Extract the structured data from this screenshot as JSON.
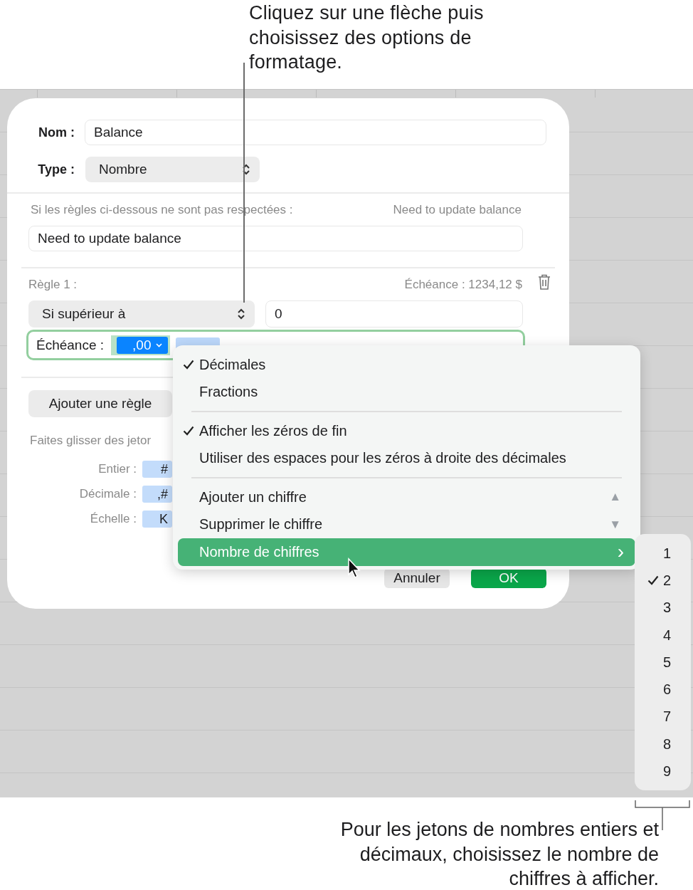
{
  "top_callout": "Cliquez sur une flèche puis choisissez des options de formatage.",
  "dialog": {
    "name_label": "Nom :",
    "name_value": "Balance",
    "type_label": "Type :",
    "type_value": "Nombre",
    "fallback_label": "Si les règles ci-dessous ne sont pas respectées :",
    "fallback_preview": "Need to update balance",
    "fallback_value": "Need to update balance",
    "rule_label": "Règle 1 :",
    "rule_preview": "Échéance : 1234,12 $",
    "condition": "Si supérieur à",
    "condition_value": "0",
    "format_label": "Échéance :",
    "format_token": {
      "text": ",00",
      "selected": true
    },
    "add_rule": "Ajouter une règle",
    "drag_hint": "Faites glisser des jetor",
    "tokens": [
      {
        "label": "Entier :",
        "token": "#"
      },
      {
        "label": "Décimale :",
        "token": ",#"
      },
      {
        "label": "Échelle :",
        "token": "K"
      }
    ],
    "cancel": "Annuler",
    "ok": "OK"
  },
  "menu": [
    {
      "kind": "item",
      "label": "Décimales",
      "checked": true,
      "selected": false
    },
    {
      "kind": "item",
      "label": "Fractions",
      "checked": false,
      "selected": false
    },
    {
      "kind": "separator"
    },
    {
      "kind": "item",
      "label": "Afficher les zéros de fin",
      "checked": true,
      "selected": false
    },
    {
      "kind": "item",
      "label": "Utiliser des espaces pour les zéros à droite des décimales",
      "checked": false,
      "selected": false
    },
    {
      "kind": "separator"
    },
    {
      "kind": "item",
      "label": "Ajouter un chiffre",
      "checked": false,
      "selected": false,
      "arrow": "▲"
    },
    {
      "kind": "item",
      "label": "Supprimer le chiffre",
      "checked": false,
      "selected": false,
      "arrow": "▼"
    },
    {
      "kind": "item",
      "label": "Nombre de chiffres",
      "checked": false,
      "selected": true,
      "arrow": "›"
    }
  ],
  "submenu": [
    {
      "label": "1",
      "checked": false
    },
    {
      "label": "2",
      "checked": true
    },
    {
      "label": "3",
      "checked": false
    },
    {
      "label": "4",
      "checked": false
    },
    {
      "label": "5",
      "checked": false
    },
    {
      "label": "6",
      "checked": false
    },
    {
      "label": "7",
      "checked": false
    },
    {
      "label": "8",
      "checked": false
    },
    {
      "label": "9",
      "checked": false
    }
  ],
  "bottom_callout": "Pour les jetons de nombres entiers et décimaux, choisissez le nombre de chiffres à afficher."
}
